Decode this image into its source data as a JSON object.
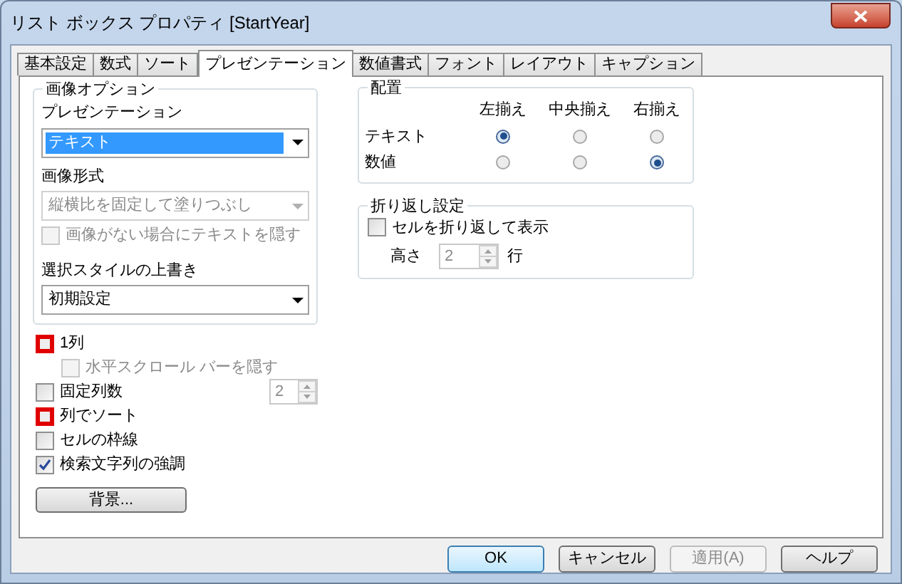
{
  "window": {
    "title": "リスト ボックス プロパティ [StartYear]"
  },
  "tabs": [
    {
      "label": "基本設定",
      "selected": false
    },
    {
      "label": "数式",
      "selected": false
    },
    {
      "label": "ソート",
      "selected": false
    },
    {
      "label": "プレゼンテーション",
      "selected": true
    },
    {
      "label": "数値書式",
      "selected": false
    },
    {
      "label": "フォント",
      "selected": false
    },
    {
      "label": "レイアウト",
      "selected": false
    },
    {
      "label": "キャプション",
      "selected": false
    }
  ],
  "image_options": {
    "title": "画像オプション",
    "presentation_label": "プレゼンテーション",
    "presentation_value": "テキスト",
    "format_label": "画像形式",
    "format_value": "縦横比を固定して塗りつぶし",
    "format_disabled": true,
    "hide_text": {
      "label": "画像がない場合にテキストを隠す",
      "checked": false,
      "disabled": true
    },
    "style_label": "選択スタイルの上書き",
    "style_value": "初期設定"
  },
  "alignment": {
    "title": "配置",
    "columns": [
      "左揃え",
      "中央揃え",
      "右揃え"
    ],
    "rows": [
      {
        "label": "テキスト",
        "options": [
          {
            "selected": true
          },
          {
            "selected": false
          },
          {
            "selected": false
          }
        ]
      },
      {
        "label": "数値",
        "options": [
          {
            "selected": false
          },
          {
            "selected": false
          },
          {
            "selected": true
          }
        ]
      }
    ]
  },
  "wrap": {
    "title": "折り返し設定",
    "checkbox": {
      "label": "セルを折り返して表示",
      "checked": false
    },
    "height_label": "高さ",
    "height_value": "2",
    "unit": "行",
    "height_disabled": true
  },
  "options": [
    {
      "kind": "checkbox",
      "label": "1列",
      "checked": false,
      "highlighted": true,
      "children": [
        {
          "kind": "checkbox",
          "label": "水平スクロール バーを隠す",
          "checked": false,
          "disabled": true,
          "highlighted": false
        }
      ]
    },
    {
      "kind": "spinner",
      "label": "固定列数",
      "checked": false,
      "highlighted": false,
      "value": "2",
      "disabled": true
    },
    {
      "kind": "checkbox",
      "label": "列でソート",
      "checked": false,
      "highlighted": true
    },
    {
      "kind": "checkbox",
      "label": "セルの枠線",
      "checked": false,
      "highlighted": false
    },
    {
      "kind": "checkbox",
      "label": "検索文字列の強調",
      "checked": true,
      "highlighted": false
    }
  ],
  "background_button": "背景...",
  "buttons": [
    {
      "label": "OK",
      "default": true,
      "disabled": false
    },
    {
      "label": "キャンセル",
      "default": false,
      "disabled": false
    },
    {
      "label": "適用(A)",
      "default": false,
      "disabled": true
    },
    {
      "label": "ヘルプ",
      "default": false,
      "disabled": false
    }
  ]
}
